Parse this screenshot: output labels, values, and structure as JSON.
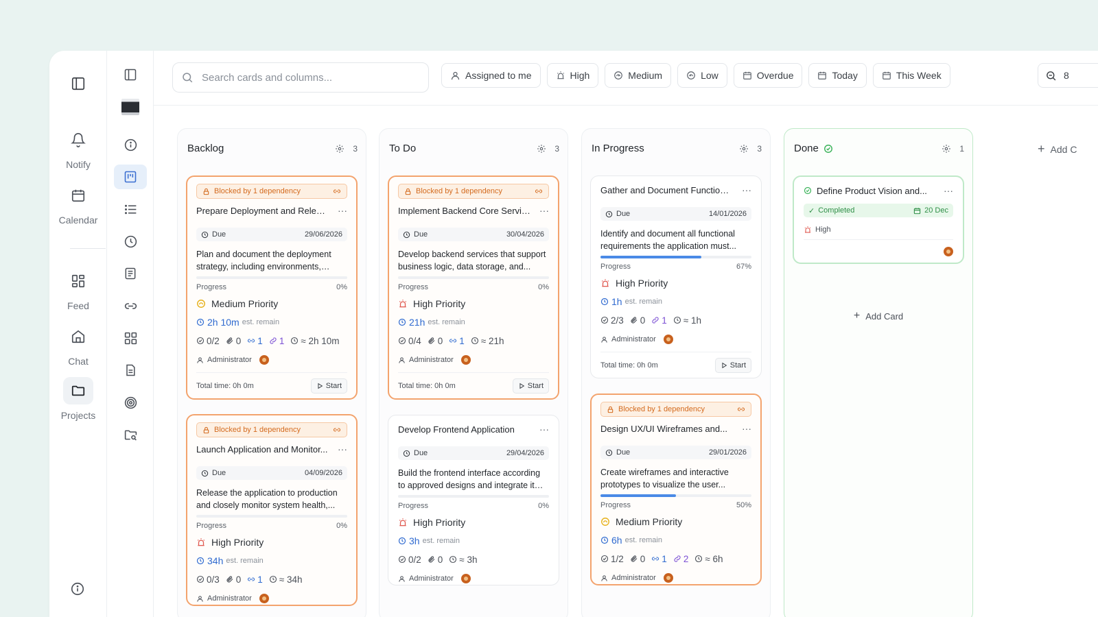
{
  "rail": {
    "items": [
      {
        "label": "Notify",
        "icon": "bell-icon"
      },
      {
        "label": "Calendar",
        "icon": "calendar-icon"
      },
      {
        "label": "Feed",
        "icon": "feed-icon"
      },
      {
        "label": "Chat",
        "icon": "home-icon"
      },
      {
        "label": "Projects",
        "icon": "folder-icon"
      }
    ]
  },
  "search": {
    "placeholder": "Search cards and columns..."
  },
  "filters": [
    {
      "label": "Assigned to me",
      "icon": "user-icon"
    },
    {
      "label": "High",
      "icon": "alarm-icon"
    },
    {
      "label": "Medium",
      "icon": "gauge-icon"
    },
    {
      "label": "Low",
      "icon": "gauge-icon"
    },
    {
      "label": "Overdue",
      "icon": "calendar-icon"
    },
    {
      "label": "Today",
      "icon": "calendar-icon"
    },
    {
      "label": "This Week",
      "icon": "calendar-icon"
    }
  ],
  "zoom": {
    "value": "8"
  },
  "columns": [
    {
      "title": "Backlog",
      "count": "3",
      "cards": [
        {
          "blocked": "Blocked by 1 dependency",
          "title": "Prepare Deployment and Releas...",
          "due_label": "Due",
          "due": "29/06/2026",
          "desc": "Plan and document the deployment strategy, including environments, rollba...",
          "progress_label": "Progress",
          "progress": "0%",
          "progress_value": 0,
          "priority": "Medium Priority",
          "est": "2h 10m",
          "est_label": "est. remain",
          "subtasks": "0/2",
          "attachments": "0",
          "links": "1",
          "deps": "1",
          "time_est": "≈ 2h 10m",
          "assignee": "Administrator",
          "total": "Total time: 0h 0m",
          "start": "Start"
        },
        {
          "blocked": "Blocked by 1 dependency",
          "title": "Launch Application and Monitor...",
          "due_label": "Due",
          "due": "04/09/2026",
          "desc": "Release the application to production and closely monitor system health,...",
          "progress_label": "Progress",
          "progress": "0%",
          "progress_value": 0,
          "priority": "High Priority",
          "est": "34h",
          "est_label": "est. remain",
          "subtasks": "0/3",
          "attachments": "0",
          "links": "1",
          "deps": "",
          "time_est": "≈ 34h",
          "assignee": "Administrator",
          "total": "Total time: 0h 0m",
          "start": "Start"
        }
      ]
    },
    {
      "title": "To Do",
      "count": "3",
      "cards": [
        {
          "blocked": "Blocked by 1 dependency",
          "title": "Implement Backend Core Services",
          "due_label": "Due",
          "due": "30/04/2026",
          "desc": "Develop backend services that support business logic, data storage, and...",
          "progress_label": "Progress",
          "progress": "0%",
          "progress_value": 0,
          "priority": "High Priority",
          "est": "21h",
          "est_label": "est. remain",
          "subtasks": "0/4",
          "attachments": "0",
          "links": "1",
          "deps": "",
          "time_est": "≈ 21h",
          "assignee": "Administrator",
          "total": "Total time: 0h 0m",
          "start": "Start"
        },
        {
          "blocked": "",
          "title": "Develop Frontend Application",
          "due_label": "Due",
          "due": "29/04/2026",
          "desc": "Build the frontend interface according to approved designs and integrate it with...",
          "progress_label": "Progress",
          "progress": "0%",
          "progress_value": 0,
          "priority": "High Priority",
          "est": "3h",
          "est_label": "est. remain",
          "subtasks": "0/2",
          "attachments": "0",
          "links": "",
          "deps": "",
          "time_est": "≈ 3h",
          "assignee": "Administrator",
          "total": "Total time: 0h 0m",
          "start": "Start"
        }
      ]
    },
    {
      "title": "In Progress",
      "count": "3",
      "cards": [
        {
          "blocked": "",
          "title": "Gather and Document Functional...",
          "due_label": "Due",
          "due": "14/01/2026",
          "desc": "Identify and document all functional requirements the application must...",
          "progress_label": "Progress",
          "progress": "67%",
          "progress_value": 0.67,
          "priority": "High Priority",
          "est": "1h",
          "est_label": "est. remain",
          "subtasks": "2/3",
          "attachments": "0",
          "links": "",
          "deps": "1",
          "time_est": "≈ 1h",
          "assignee": "Administrator",
          "total": "Total time: 0h 0m",
          "start": "Start"
        },
        {
          "blocked": "Blocked by 1 dependency",
          "title": "Design UX/UI Wireframes and...",
          "due_label": "Due",
          "due": "29/01/2026",
          "desc": "Create wireframes and interactive prototypes to visualize the user...",
          "progress_label": "Progress",
          "progress": "50%",
          "progress_value": 0.5,
          "priority": "Medium Priority",
          "est": "6h",
          "est_label": "est. remain",
          "subtasks": "1/2",
          "attachments": "0",
          "links": "1",
          "deps": "2",
          "time_est": "≈ 6h",
          "assignee": "Administrator",
          "total": "Total time: 0h 0m",
          "start": "Start"
        }
      ]
    },
    {
      "title": "Done",
      "count": "1",
      "done_card": {
        "title": "Define Product Vision and...",
        "status": "Completed",
        "date": "20 Dec",
        "priority": "High"
      },
      "add_card": "Add Card"
    }
  ],
  "add_column": "Add C",
  "colors": {
    "accent": "#3b6fd1",
    "blocked": "#f3a36d",
    "done": "#3bb35a",
    "progress": "#4a8ae6"
  }
}
